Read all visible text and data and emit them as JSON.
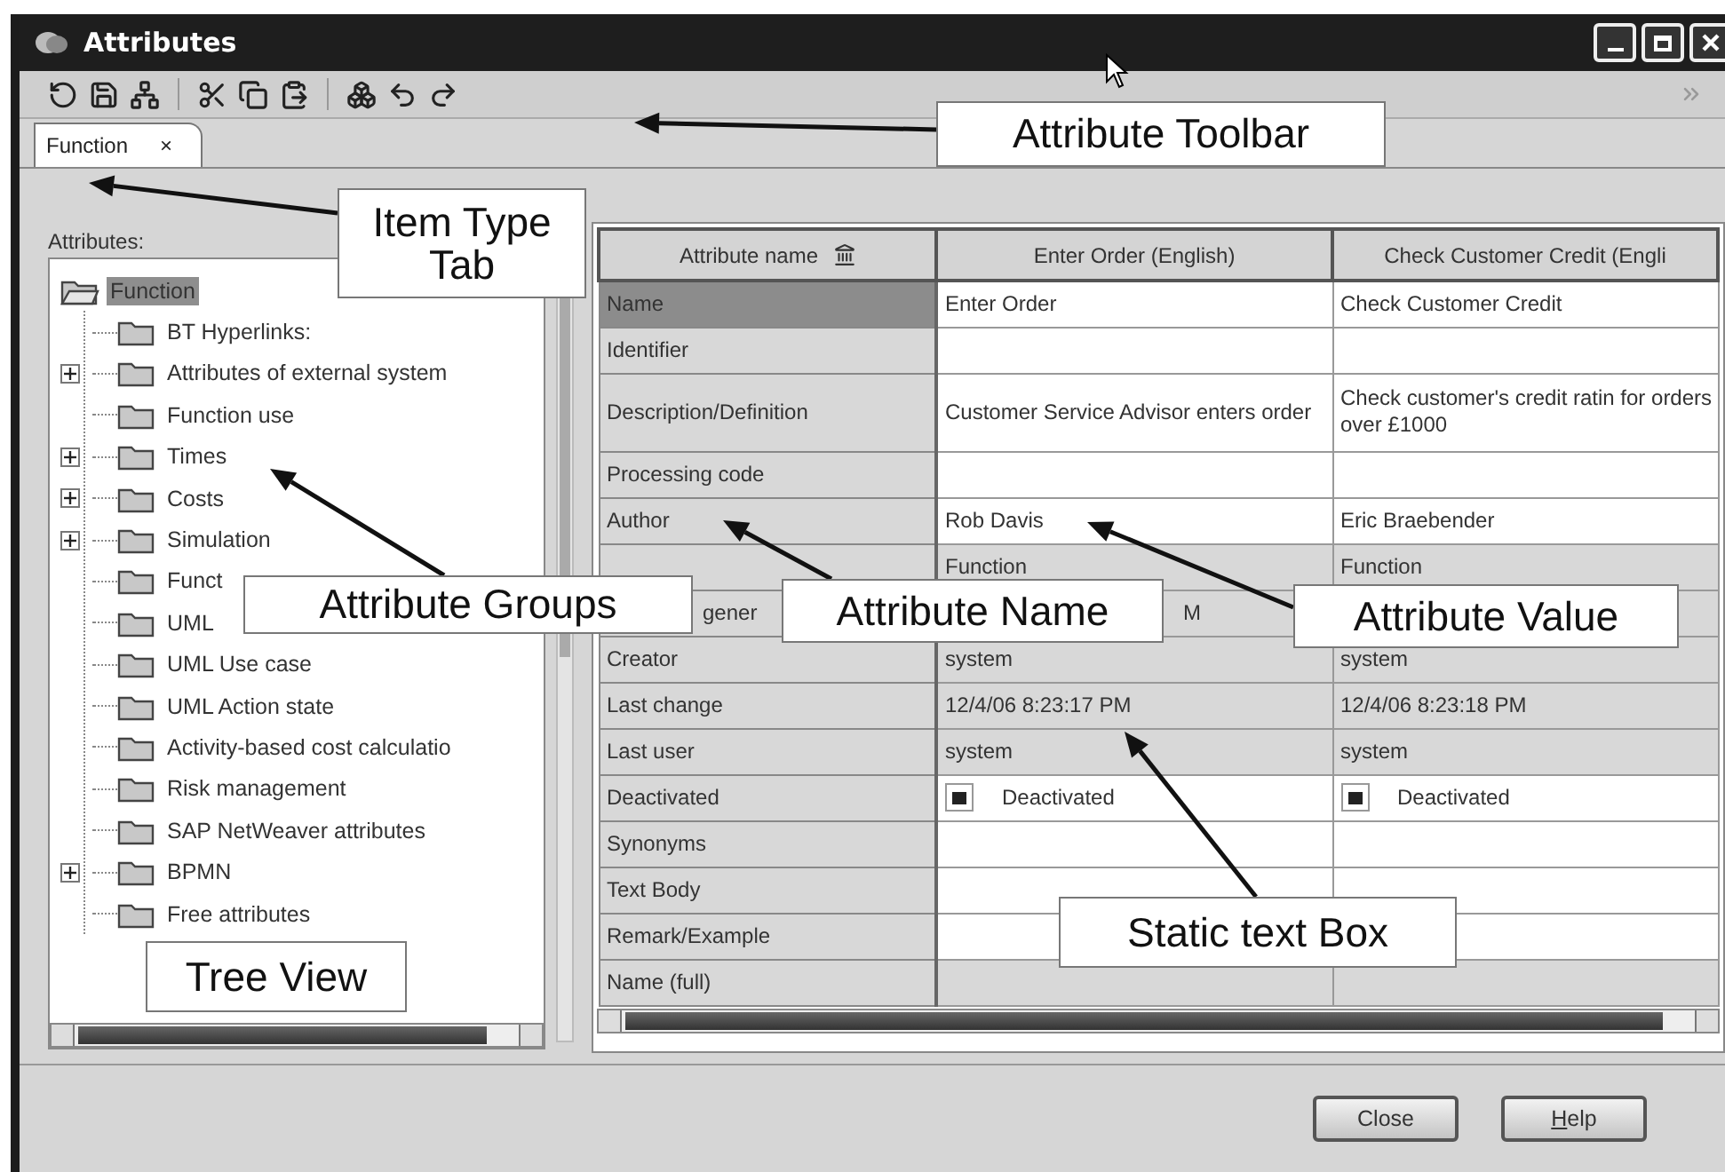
{
  "window": {
    "title": "Attributes"
  },
  "tabs": [
    {
      "label": "Function",
      "close": "×",
      "selected": true
    }
  ],
  "tree": {
    "label": "Attributes:",
    "items": [
      {
        "label": "Function",
        "selected": true,
        "expanded": true,
        "children": [
          {
            "label": "BT Hyperlinks:",
            "selected": false
          },
          {
            "label": "Attributes of external system",
            "selected": false,
            "expanded": false
          },
          {
            "label": "Function use",
            "selected": false
          },
          {
            "label": "Times",
            "selected": false,
            "expanded": false
          },
          {
            "label": "Costs",
            "selected": false,
            "expanded": false
          },
          {
            "label": "Simulation",
            "selected": false,
            "expanded": false
          },
          {
            "label": "Funct",
            "selected": false
          },
          {
            "label": "UML",
            "selected": false
          },
          {
            "label": "UML Use case",
            "selected": false
          },
          {
            "label": "UML Action state",
            "selected": false
          },
          {
            "label": "Activity-based cost calculatio",
            "selected": false
          },
          {
            "label": "Risk management",
            "selected": false
          },
          {
            "label": "SAP NetWeaver attributes",
            "selected": false
          },
          {
            "label": "BPMN",
            "selected": false,
            "expanded": false
          },
          {
            "label": "Free attributes",
            "selected": false
          }
        ]
      }
    ]
  },
  "table": {
    "columns": [
      "Attribute name",
      "Enter Order (English)",
      "Check Customer Credit (Engli"
    ],
    "rows": [
      {
        "selected": true,
        "editable": true,
        "cells": [
          {
            "kind": "text",
            "text": "Name"
          },
          {
            "kind": "text",
            "text": "Enter Order"
          },
          {
            "kind": "text",
            "text": "Check Customer Credit"
          }
        ]
      },
      {
        "selected": false,
        "editable": true,
        "cells": [
          {
            "kind": "text",
            "text": "Identifier"
          },
          {
            "kind": "blank"
          },
          {
            "kind": "blank"
          }
        ]
      },
      {
        "selected": false,
        "editable": true,
        "cells": [
          {
            "kind": "text",
            "text": "Description/Definition"
          },
          {
            "kind": "text",
            "text": "Customer Service Advisor enters order"
          },
          {
            "kind": "text",
            "text": "Check customer's credit ratin for orders over £1000"
          }
        ]
      },
      {
        "selected": false,
        "editable": true,
        "cells": [
          {
            "kind": "text",
            "text": "Processing code"
          },
          {
            "kind": "blank"
          },
          {
            "kind": "blank"
          }
        ]
      },
      {
        "selected": false,
        "editable": true,
        "cells": [
          {
            "kind": "text",
            "text": "Author"
          },
          {
            "kind": "text",
            "text": "Rob Davis"
          },
          {
            "kind": "text",
            "text": "Eric Braebender"
          }
        ]
      },
      {
        "selected": false,
        "editable": false,
        "cells": [
          {
            "kind": "blank"
          },
          {
            "kind": "text",
            "text": "Function"
          },
          {
            "kind": "text",
            "text": "Function"
          }
        ]
      },
      {
        "selected": false,
        "editable": false,
        "cells": [
          {
            "kind": "clipped",
            "text": "gener"
          },
          {
            "kind": "clipped",
            "text": "M"
          },
          {
            "kind": "blank"
          }
        ]
      },
      {
        "selected": false,
        "editable": false,
        "cells": [
          {
            "kind": "text",
            "text": "Creator"
          },
          {
            "kind": "text",
            "text": "system"
          },
          {
            "kind": "text",
            "text": "system"
          }
        ]
      },
      {
        "selected": false,
        "editable": false,
        "cells": [
          {
            "kind": "text",
            "text": "Last change"
          },
          {
            "kind": "text",
            "text": "12/4/06 8:23:17 PM"
          },
          {
            "kind": "text",
            "text": "12/4/06 8:23:18 PM"
          }
        ]
      },
      {
        "selected": false,
        "editable": false,
        "cells": [
          {
            "kind": "text",
            "text": "Last user"
          },
          {
            "kind": "text",
            "text": "system"
          },
          {
            "kind": "text",
            "text": "system"
          }
        ]
      },
      {
        "selected": false,
        "editable": true,
        "cells": [
          {
            "kind": "text",
            "text": "Deactivated"
          },
          {
            "kind": "checkbox",
            "text": "Deactivated",
            "checked": true
          },
          {
            "kind": "checkbox",
            "text": "Deactivated",
            "checked": true
          }
        ]
      },
      {
        "selected": false,
        "editable": true,
        "cells": [
          {
            "kind": "text",
            "text": "Synonyms"
          },
          {
            "kind": "blank"
          },
          {
            "kind": "blank"
          }
        ]
      },
      {
        "selected": false,
        "editable": true,
        "cells": [
          {
            "kind": "text",
            "text": "Text Body"
          },
          {
            "kind": "blank"
          },
          {
            "kind": "blank"
          }
        ]
      },
      {
        "selected": false,
        "editable": true,
        "cells": [
          {
            "kind": "text",
            "text": "Remark/Example"
          },
          {
            "kind": "blank"
          },
          {
            "kind": "blank"
          }
        ]
      },
      {
        "selected": false,
        "editable": false,
        "cells": [
          {
            "kind": "text",
            "text": "Name (full)"
          },
          {
            "kind": "blank"
          },
          {
            "kind": "blank"
          }
        ]
      }
    ]
  },
  "buttons": [
    "Close",
    "Help"
  ],
  "callouts": [
    {
      "text": "Attribute Toolbar"
    },
    {
      "text": "Item Type Tab"
    },
    {
      "text": "Attribute Groups"
    },
    {
      "text": "Attribute Name"
    },
    {
      "text": "Attribute Value"
    },
    {
      "text": "Static text Box"
    },
    {
      "text": "Tree View"
    }
  ]
}
